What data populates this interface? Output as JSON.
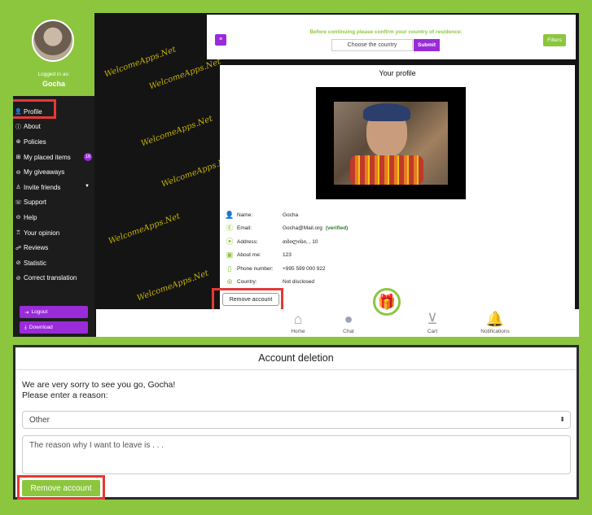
{
  "sidebar": {
    "logged_in_label": "Logged in as:",
    "username": "Gocha",
    "items": [
      {
        "label": "Profile",
        "icon": "user-icon"
      },
      {
        "label": "About",
        "icon": "info-icon"
      },
      {
        "label": "Policies",
        "icon": "policy-icon"
      },
      {
        "label": "My placed items",
        "icon": "items-icon",
        "badge": "16"
      },
      {
        "label": "My giveaways",
        "icon": "giveaway-icon"
      },
      {
        "label": "Invite friends",
        "icon": "invite-icon"
      },
      {
        "label": "Support",
        "icon": "support-icon"
      },
      {
        "label": "Help",
        "icon": "help-icon"
      },
      {
        "label": "Your opinion",
        "icon": "opinion-icon"
      },
      {
        "label": "Reviews",
        "icon": "reviews-icon"
      },
      {
        "label": "Statistic",
        "icon": "statistic-icon"
      },
      {
        "label": "Correct translation",
        "icon": "translation-icon"
      }
    ],
    "logout_label": "Logout",
    "download_label": "Download"
  },
  "watermark_text": "WelcomeApps.Net",
  "filter_bar": {
    "confirm_text": "Before continuing please confirm your country of residence:",
    "country_placeholder": "Choose the country",
    "submit_label": "Submit",
    "filters_label": "Filters"
  },
  "profile": {
    "title": "Your profile",
    "fields": [
      {
        "label": "Name:",
        "value": "Gocha",
        "icon": "person-icon"
      },
      {
        "label": "Email:",
        "value": "Gocha@Mail.org",
        "icon": "email-icon",
        "verified": "(verified)"
      },
      {
        "label": "Address:",
        "value": "თბილისი, , 10",
        "icon": "location-icon"
      },
      {
        "label": "About me:",
        "value": "123",
        "icon": "about-icon"
      },
      {
        "label": "Phone number:",
        "value": "+995 599 000 922",
        "icon": "phone-icon"
      },
      {
        "label": "Country:",
        "value": "Not disclosed",
        "icon": "globe-icon"
      }
    ],
    "remove_label": "Remove account"
  },
  "bottom_nav": [
    {
      "label": "Home",
      "icon": "home-icon"
    },
    {
      "label": "Chat",
      "icon": "chat-icon"
    },
    {
      "label": "Cart",
      "icon": "cart-icon"
    },
    {
      "label": "Notifications",
      "icon": "bell-icon"
    }
  ],
  "dialog": {
    "title": "Account deletion",
    "message_line1": "We are very sorry to see you go, Gocha!",
    "message_line2": "Please enter a reason:",
    "reason_selected": "Other",
    "reason_text": "The reason why I want to leave is . . .",
    "remove_label": "Remove account"
  },
  "colors": {
    "accent_green": "#8cc63f",
    "accent_purple": "#9a2bd9",
    "highlight_red": "#e53935"
  }
}
